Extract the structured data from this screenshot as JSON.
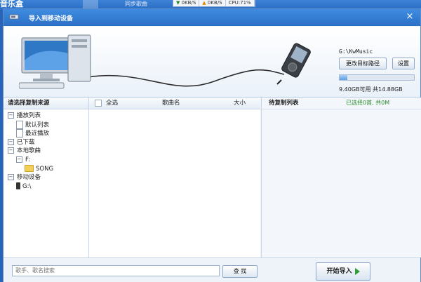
{
  "background_app": {
    "title": "音乐盒",
    "tabs": [
      "",
      "同步歌曲"
    ],
    "stats": [
      "0KB/S",
      "0KB/S",
      "CPU:71%"
    ]
  },
  "dialog": {
    "title": "导入到移动设备",
    "close_glyph": "×"
  },
  "device": {
    "path": "G:\\KwMusic",
    "change_dir_label": "更改目标路径",
    "settings_label": "设置",
    "storage_used_fraction": 0.1,
    "storage_text": "9.40GB可用  共14.88GB"
  },
  "source_panel": {
    "header": "请选择复制来源",
    "tree": [
      {
        "label": "播放列表",
        "level": 0,
        "icon": "expand-icon"
      },
      {
        "label": "默认列表",
        "level": 1,
        "icon": "document-icon"
      },
      {
        "label": "最近播放",
        "level": 1,
        "icon": "document-icon"
      },
      {
        "label": "已下载",
        "level": 0,
        "icon": "expand-icon"
      },
      {
        "label": "本地歌曲",
        "level": 0,
        "icon": "expand-icon"
      },
      {
        "label": "F:",
        "level": 1,
        "icon": "expand-icon"
      },
      {
        "label": "SONG",
        "level": 2,
        "icon": "folder-icon"
      },
      {
        "label": "移动设备",
        "level": 0,
        "icon": "expand-icon"
      },
      {
        "label": "G:\\",
        "level": 1,
        "icon": "phone-icon"
      }
    ]
  },
  "song_panel": {
    "select_all": "全选",
    "col_name": "歌曲名",
    "col_size": "大小"
  },
  "copy_panel": {
    "header": "待复制列表",
    "selected_text": "已选择0首, 共0M"
  },
  "bottom": {
    "search_placeholder": "歌手、歌名搜索",
    "find_label": "查 找",
    "start_label": "开始导入"
  },
  "colors": {
    "title_bar": "#2b70c8",
    "accent_green": "#2e9e3a"
  }
}
